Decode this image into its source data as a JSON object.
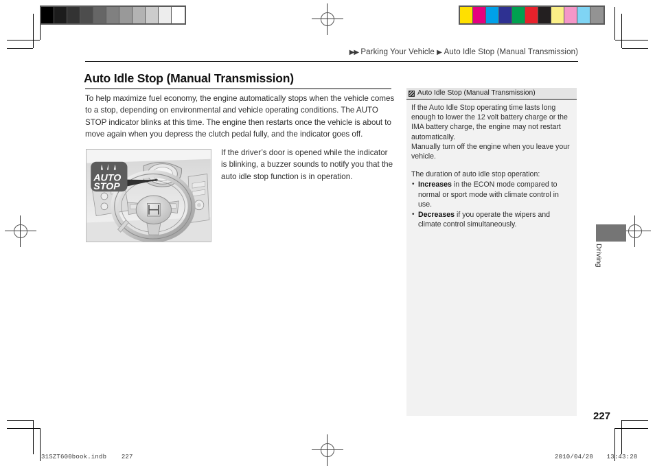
{
  "breadcrumb": {
    "arrows": "▶▶",
    "parent": "Parking Your Vehicle",
    "separator": "▶",
    "current": "Auto Idle Stop (Manual Transmission)"
  },
  "page_title": "Auto Idle Stop (Manual Transmission)",
  "body": {
    "intro": "To help maximize fuel economy, the engine automatically stops when the vehicle comes to a stop, depending on environmental and vehicle operating conditions. The AUTO STOP indicator blinks at this time. The engine then restarts once the vehicle is about to move again when you depress the clutch pedal fully, and the indicator goes off.",
    "secondary": "If the driver’s door is opened while the indicator is blinking, a buzzer sounds to notify you that the auto idle stop function is in operation."
  },
  "figure": {
    "badge_line1": "AUTO",
    "badge_line2": "STOP",
    "alt": "steering-wheel-instrument-cluster-illustration"
  },
  "note": {
    "icon": "book-reference-icon",
    "title": "Auto Idle Stop (Manual Transmission)",
    "paragraph1": "If the Auto Idle Stop operating time lasts long enough to lower the 12 volt battery charge or the IMA battery charge, the engine may not restart automatically.",
    "paragraph2": "Manually turn off the engine when you leave your vehicle.",
    "list_intro": "The duration of auto idle stop operation:",
    "items": [
      {
        "lead": "Increases",
        "rest": " in the ECON mode compared to normal or sport mode with climate control in use."
      },
      {
        "lead": "Decreases",
        "rest": " if you operate the wipers and climate control simultaneously."
      }
    ]
  },
  "thumb_tab": {
    "label": "Driving",
    "color": "#757575"
  },
  "page_number": "227",
  "footer": {
    "file_name": "31SZT600book.indb",
    "file_page": "227",
    "date": "2010/04/28",
    "time": "13:43:28"
  },
  "calibration": {
    "gray_steps": [
      "#000000",
      "#1c1c1c",
      "#333333",
      "#4d4d4d",
      "#666666",
      "#808080",
      "#999999",
      "#b3b3b3",
      "#cccccc",
      "#ededed",
      "#ffffff"
    ],
    "color_steps": [
      "#ffe000",
      "#e5007f",
      "#00a0e9",
      "#2e3192",
      "#00a050",
      "#e8212b",
      "#231f20",
      "#fbef87",
      "#f497c8",
      "#7fd4f4",
      "#939393"
    ]
  }
}
